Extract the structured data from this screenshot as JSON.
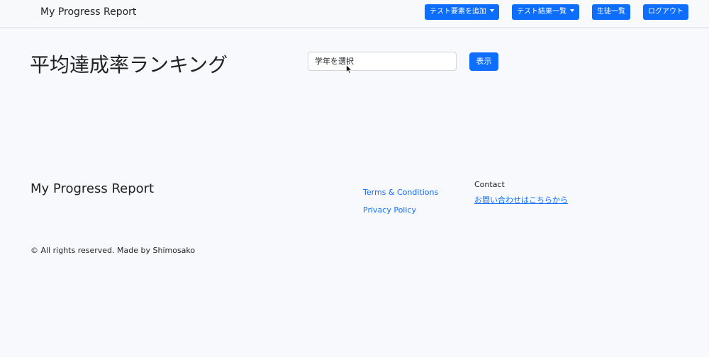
{
  "navbar": {
    "brand": "My Progress Report",
    "items": [
      {
        "label": "テスト要素を追加",
        "dropdown": true
      },
      {
        "label": "テスト結果一覧",
        "dropdown": true
      },
      {
        "label": "生徒一覧",
        "dropdown": false
      },
      {
        "label": "ログアウト",
        "dropdown": false
      }
    ]
  },
  "main": {
    "title": "平均達成率ランキング",
    "grade_select": {
      "selected": "学年を選択"
    },
    "show_button": "表示"
  },
  "footer": {
    "brand": "My Progress Report",
    "links": [
      "Terms & Conditions",
      "Privacy Policy"
    ],
    "contact": {
      "heading": "Contact",
      "link": "お問い合わせはこちらから"
    },
    "copyright": "© All rights reserved. Made by Shimosako"
  },
  "colors": {
    "primary": "#0d6efd",
    "background": "#f8f9fc",
    "navbar": "#f8f9fa"
  }
}
